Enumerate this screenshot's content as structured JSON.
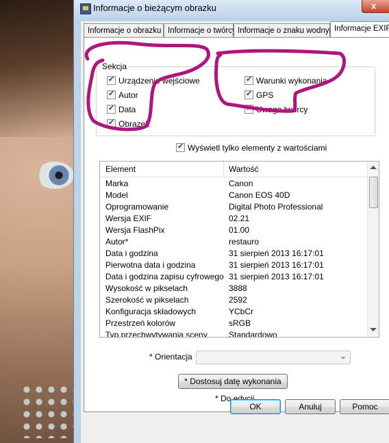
{
  "window": {
    "title": "Informacje o bieżącym obrazku",
    "close_glyph": "x"
  },
  "tabs": [
    {
      "label": "Informacje o obrazku"
    },
    {
      "label": "Informacje o twórcy"
    },
    {
      "label": "Informacje o znaku wodnym"
    },
    {
      "label": "Informacje EXIF",
      "active": true
    }
  ],
  "section": {
    "legend": "Sekcja",
    "left": [
      {
        "label": "Urządzenie wejściowe",
        "checked": true
      },
      {
        "label": "Autor",
        "checked": true
      },
      {
        "label": "Data",
        "checked": true
      },
      {
        "label": "Obrazek",
        "checked": true
      }
    ],
    "right": [
      {
        "label": "Warunki wykonania",
        "checked": true
      },
      {
        "label": "GPS",
        "checked": true
      },
      {
        "label": "Uwaga twórcy",
        "checked": true
      }
    ]
  },
  "only_values": {
    "label": "Wyświetl tylko elementy z wartościami",
    "checked": true
  },
  "list": {
    "col_element": "Element",
    "col_value": "Wartość",
    "rows": [
      [
        "Marka",
        "Canon"
      ],
      [
        "Model",
        "Canon EOS 40D"
      ],
      [
        "Oprogramowanie",
        "Digital Photo Professional"
      ],
      [
        "Wersja EXIF",
        "02.21"
      ],
      [
        "Wersja FlashPix",
        "01.00"
      ],
      [
        "Autor*",
        "restauro"
      ],
      [
        "Data i godzina",
        "31 sierpień 2013 16:17:01"
      ],
      [
        "Pierwotna data i godzina",
        "31 sierpień 2013 16:17:01"
      ],
      [
        "Data i godzina zapisu cyfrowego",
        "31 sierpień 2013 16:17:01"
      ],
      [
        "Wysokość w pikselach",
        "3888"
      ],
      [
        "Szerokość w pikselach",
        "2592"
      ],
      [
        "Konfiguracja składowych",
        "YCbCr"
      ],
      [
        "Przestrzeń kolorów",
        "sRGB"
      ],
      [
        "Typ przechwytywania sceny",
        "Standardowo"
      ]
    ]
  },
  "orientation": {
    "label": "* Orientacja",
    "value": ""
  },
  "adjust_date_button": "* Dostosuj datę wykonania",
  "edit_note": "* Do edycji",
  "buttons": {
    "ok": "OK",
    "cancel": "Anuluj",
    "help": "Pomoc"
  },
  "colors": {
    "annotation": "#b0157f",
    "window_frame": "#bcd3ea",
    "face_bg": "#c9a184"
  }
}
